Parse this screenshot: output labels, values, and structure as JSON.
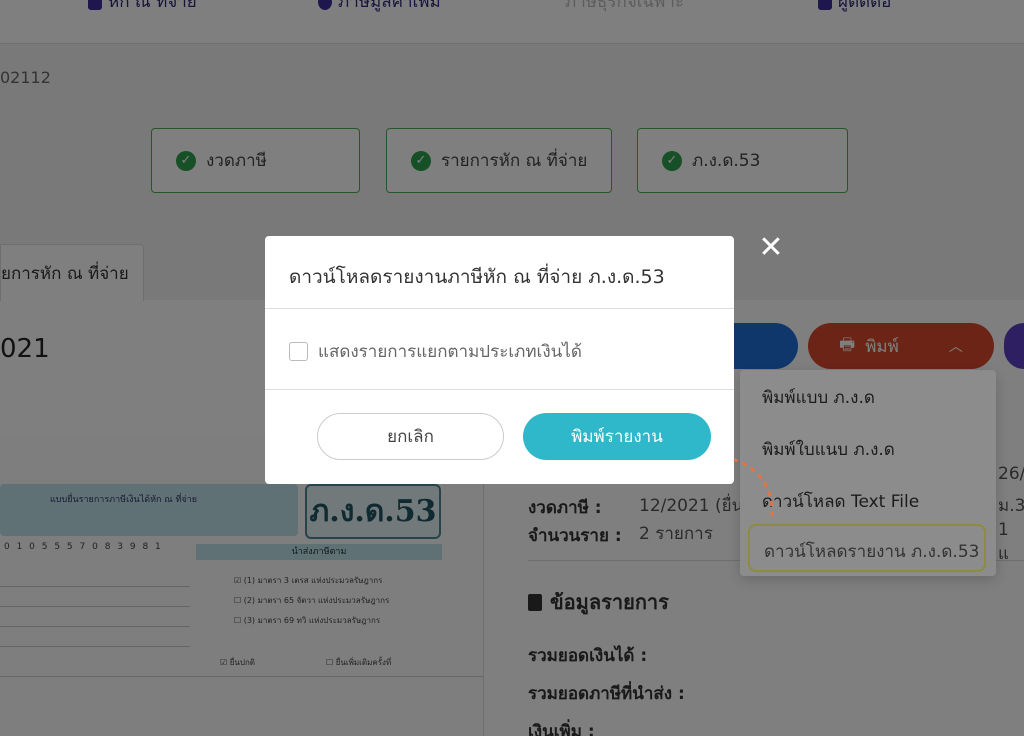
{
  "nav": {
    "items": [
      {
        "label": "หัก ณ ที่จ่าย"
      },
      {
        "label": "ภาษีมูลค่าเพิ่ม"
      },
      {
        "label": "ภาษีธุรกิจเฉพาะ"
      },
      {
        "label": "ผู้ติดต่อ"
      }
    ]
  },
  "doc_id": "02112",
  "steps": [
    {
      "label": "งวดภาษี"
    },
    {
      "label": "รายการหัก ณ ที่จ่าย"
    },
    {
      "label": "ภ.ง.ด.53"
    }
  ],
  "tab_label": "ยการหัก ณ ที่จ่าย",
  "year_text": "021",
  "toolbar": {
    "print_label": "พิมพ์"
  },
  "print_menu": {
    "items": [
      {
        "label": "พิมพ์แบบ ภ.ง.ด"
      },
      {
        "label": "พิมพ์ใบแนบ ภ.ง.ด"
      },
      {
        "label": "ดาวน์โหลด Text File"
      },
      {
        "label": "ดาวน์โหลดรายงาน ภ.ง.ด.53"
      }
    ]
  },
  "form_preview": {
    "title": "แบบยื่นรายการภาษีเงินได้หัก ณ ที่จ่าย",
    "logo": "ภ.ง.ด.53",
    "tax_id_boxes": "0 1 0 5 5 5 7 0 8 3 9 8 1",
    "section_head": "นำส่งภาษีตาม",
    "row1": "(1) มาตรา 3 เตรส แห่งประมวลรัษฎากร",
    "row2": "(2) มาตรา 65 จัตวา แห่งประมวลรัษฎากร",
    "row3": "(3) มาตรา 69 ทวิ แห่งประมวลรัษฎากร",
    "filing_normal": "ยื่นปกติ",
    "filing_extra": "ยื่นเพิ่มเติมครั้งที่"
  },
  "info": {
    "period_label": "งวดภาษี :",
    "period_value": "12/2021 (ยื่น",
    "count_label": "จำนวนราย :",
    "count_value": "2 รายการ",
    "right_top": "26/",
    "right_mid": "ม.3",
    "right_bottom": "1 แ",
    "section_title": "ข้อมูลรายการ",
    "total_income_label": "รวมยอดเงินได้ :",
    "total_tax_label": "รวมยอดภาษีที่นำส่ง :",
    "surcharge_label": "เงินเพิ่ม :"
  },
  "modal": {
    "title": "ดาวน์โหลดรายงานภาษีหัก ณ ที่จ่าย ภ.ง.ด.53",
    "checkbox_label": "แสดงรายการแยกตามประเภทเงินได้",
    "cancel_label": "ยกเลิก",
    "confirm_label": "พิมพ์รายงาน"
  },
  "colors": {
    "accent_teal": "#2fb8c9",
    "print_red": "#d9492c",
    "highlight_orange": "#f39a3d",
    "step_green": "#2e9e4f"
  },
  "icons": [
    "check-circle-icon",
    "printer-icon",
    "chevron-up-icon",
    "close-icon",
    "document-icon",
    "arrow-icon"
  ]
}
